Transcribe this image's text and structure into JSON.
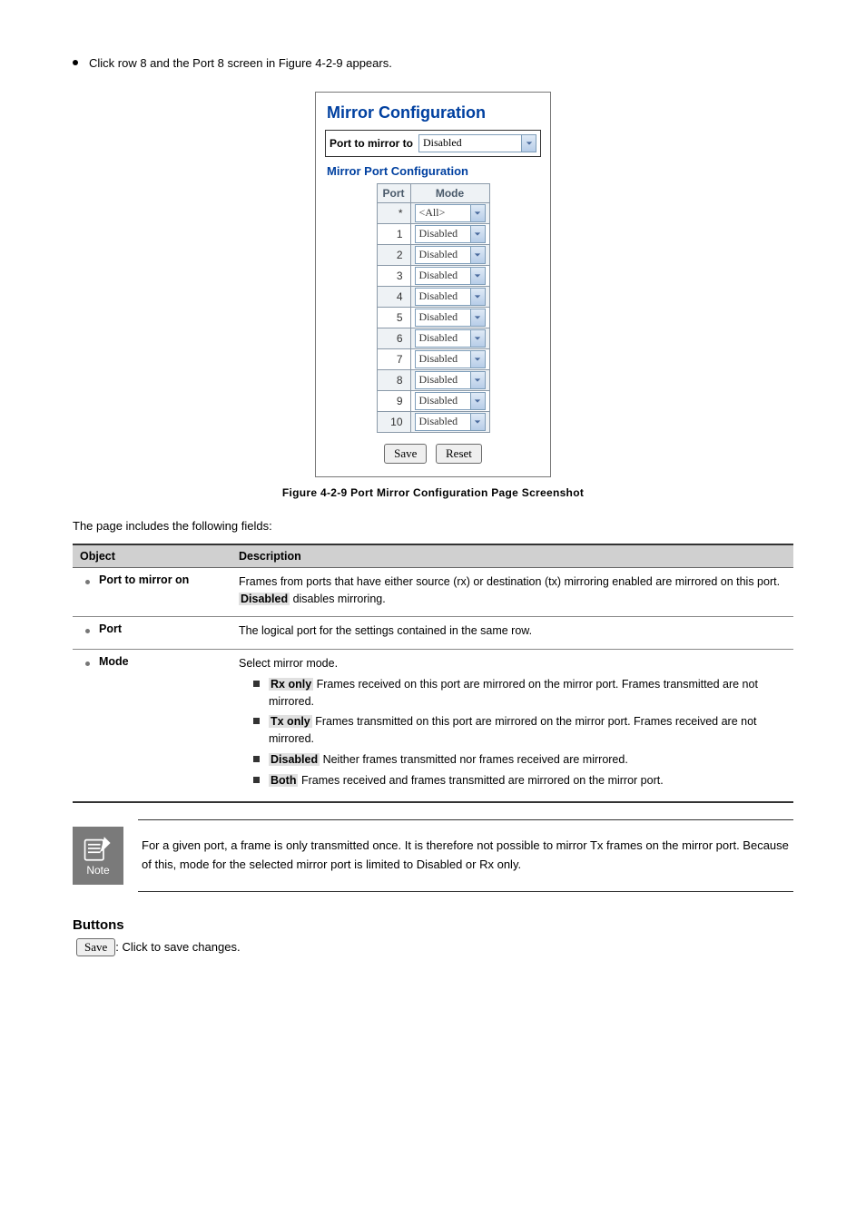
{
  "intro": {
    "line": "Click row 8 and the Port 8 screen in Figure 4-2-9 appears."
  },
  "screenshot": {
    "title": "Mirror Configuration",
    "port_to_mirror_label": "Port to mirror to",
    "port_to_mirror_value": "Disabled",
    "subtitle": "Mirror Port Configuration",
    "columns": {
      "port": "Port",
      "mode": "Mode"
    },
    "rows": [
      {
        "port": "*",
        "mode": "<All>"
      },
      {
        "port": "1",
        "mode": "Disabled"
      },
      {
        "port": "2",
        "mode": "Disabled"
      },
      {
        "port": "3",
        "mode": "Disabled"
      },
      {
        "port": "4",
        "mode": "Disabled"
      },
      {
        "port": "5",
        "mode": "Disabled"
      },
      {
        "port": "6",
        "mode": "Disabled"
      },
      {
        "port": "7",
        "mode": "Disabled"
      },
      {
        "port": "8",
        "mode": "Disabled"
      },
      {
        "port": "9",
        "mode": "Disabled"
      },
      {
        "port": "10",
        "mode": "Disabled"
      }
    ],
    "buttons": {
      "save": "Save",
      "reset": "Reset"
    }
  },
  "figure_caption": "Figure 4-2-9 Port Mirror Configuration Page Screenshot",
  "lead_text": "The page includes the following fields:",
  "table": {
    "headers": {
      "object": "Object",
      "description": "Description"
    },
    "rows": [
      {
        "object": "Port to mirror on",
        "desc_pre": "Frames from ports that have either source (rx) or destination (tx) mirroring enabled are mirrored on this port. ",
        "keyword": "Disabled",
        "desc_post": " disables mirroring."
      },
      {
        "object": "Port",
        "desc_pre": "The logical port for the settings contained in the same row.",
        "keyword": "",
        "desc_post": ""
      }
    ],
    "mode_row": {
      "object": "Mode",
      "lead": "Select mirror mode.",
      "items": [
        {
          "k": "Rx only",
          "t": " Frames received on this port are mirrored on the mirror port. Frames transmitted are not mirrored."
        },
        {
          "k": "Tx only",
          "t": " Frames transmitted on this port are mirrored on the mirror port. Frames received are not mirrored."
        },
        {
          "k": "Disabled",
          "t": " Neither frames transmitted nor frames received are mirrored."
        },
        {
          "k": "Both",
          "t": " Frames received and frames transmitted are mirrored on the mirror port."
        }
      ]
    }
  },
  "note": {
    "label": "Note",
    "text": "For a given port, a frame is only transmitted once. It is therefore not possible to mirror Tx frames on the mirror port. Because of this, mode for the selected mirror port is limited to Disabled or Rx only."
  },
  "buttons_section": {
    "heading": "Buttons",
    "save_label": "Save",
    "save_desc": ": Click to save changes."
  }
}
